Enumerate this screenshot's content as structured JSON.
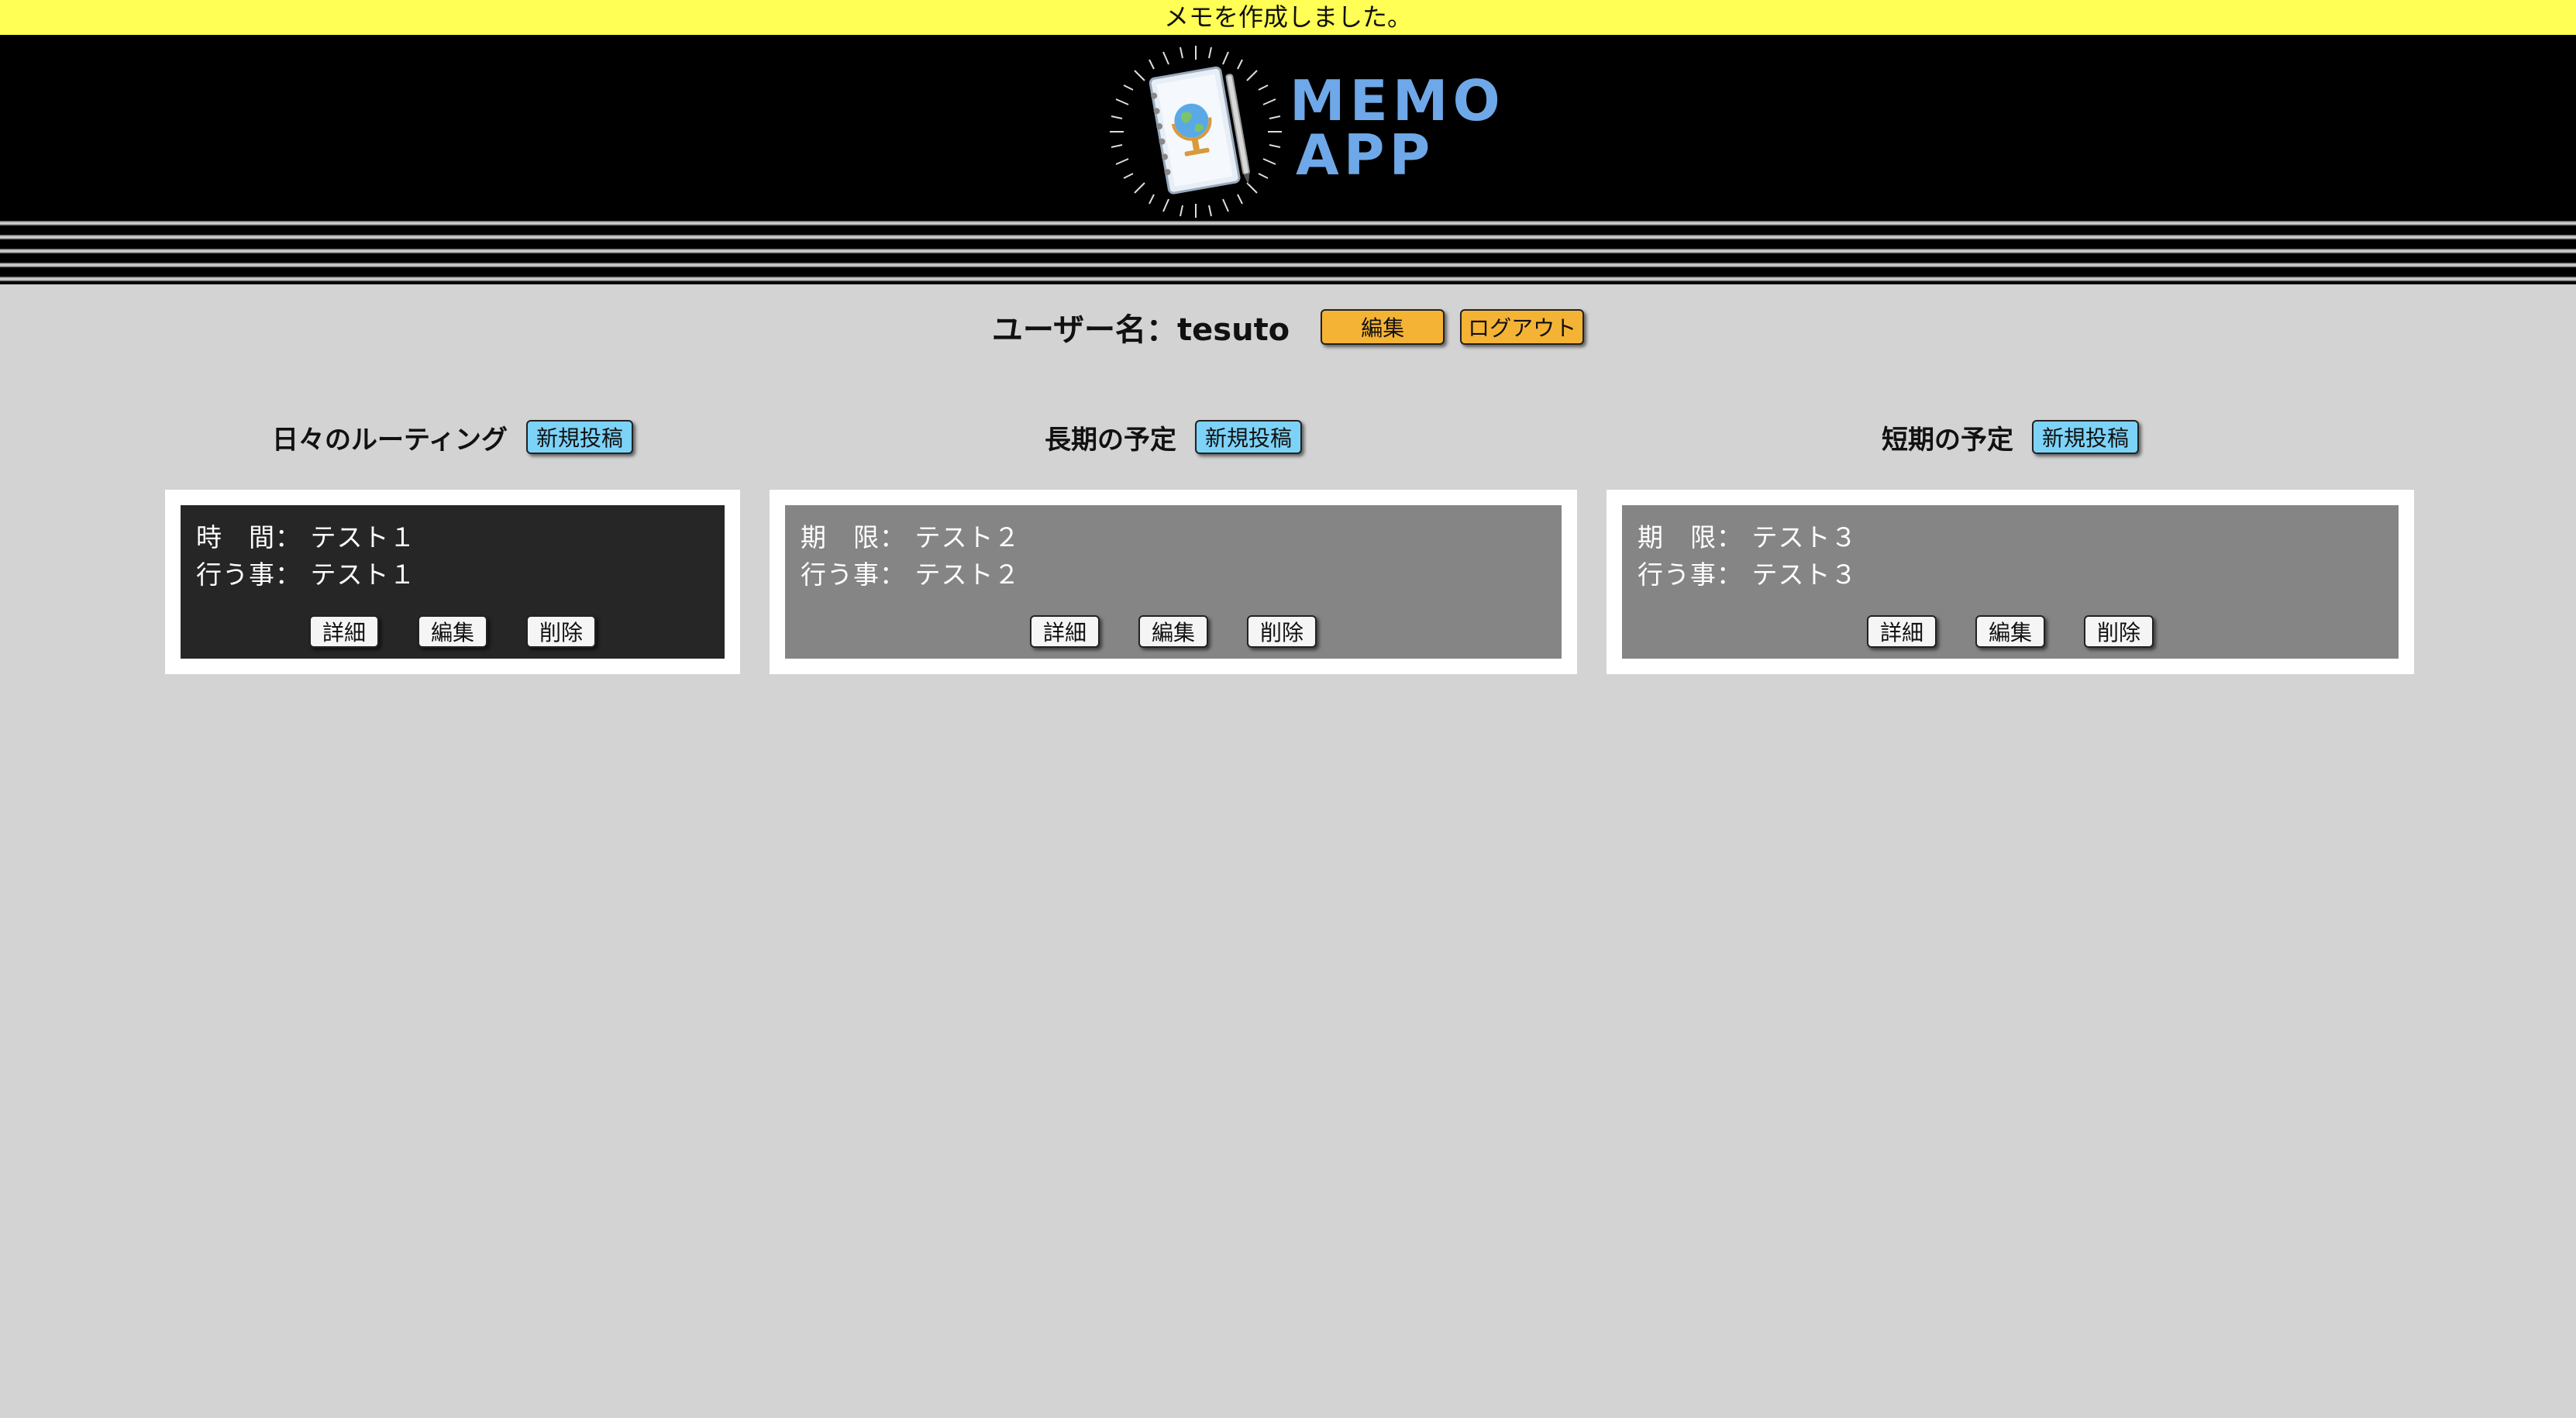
{
  "flash": {
    "message": "メモを作成しました。"
  },
  "header": {
    "logo_line1": "MEMO",
    "logo_line2": "APP"
  },
  "user": {
    "label": "ユーザー名：tesuto",
    "edit_label": "編集",
    "logout_label": "ログアウト"
  },
  "columns": [
    {
      "title": "日々のルーティング",
      "new_label": "新規投稿",
      "card": {
        "field1_label": "時　間：",
        "field1_value": "テスト１",
        "field2_label": "行う事：",
        "field2_value": "テスト１",
        "detail_label": "詳細",
        "edit_label": "編集",
        "delete_label": "削除"
      }
    },
    {
      "title": "長期の予定",
      "new_label": "新規投稿",
      "card": {
        "field1_label": "期　限：",
        "field1_value": "テスト２",
        "field2_label": "行う事：",
        "field2_value": "テスト２",
        "detail_label": "詳細",
        "edit_label": "編集",
        "delete_label": "削除"
      }
    },
    {
      "title": "短期の予定",
      "new_label": "新規投稿",
      "card": {
        "field1_label": "期　限：",
        "field1_value": "テスト３",
        "field2_label": "行う事：",
        "field2_value": "テスト３",
        "detail_label": "詳細",
        "edit_label": "編集",
        "delete_label": "削除"
      }
    }
  ],
  "colors": {
    "flash_bg": "#ffff55",
    "page_bg": "#d3d3d3",
    "logo_text": "#6ea8e8",
    "button_orange": "#f5b335",
    "button_blue": "#7dd3f7",
    "card_dark": "#262626",
    "card_gray": "#858585"
  },
  "icons": {
    "logo": "notebook-globe-icon"
  }
}
